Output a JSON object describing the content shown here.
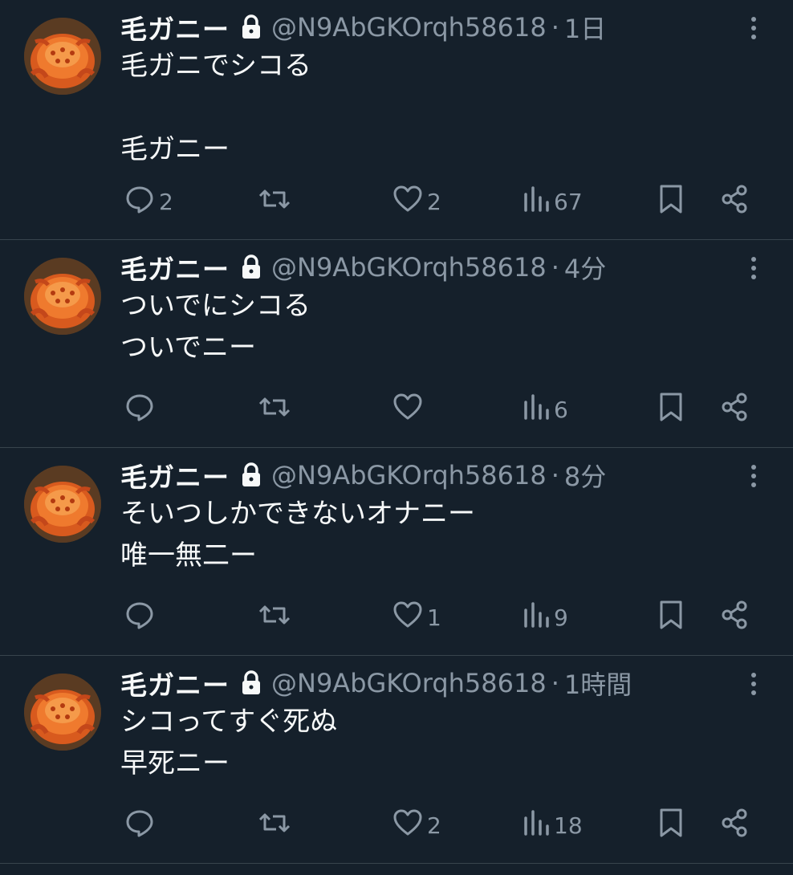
{
  "account": {
    "display_name": "毛ガニー",
    "handle": "@N9AbGKOrqh58618",
    "avatar_icon": "crab-photo-avatar",
    "protected_icon": "lock-icon"
  },
  "separator": "·",
  "tweets": [
    {
      "time": "1日",
      "text": "毛ガニでシコる\n\n毛ガニー",
      "replies": "2",
      "retweets": "",
      "likes": "2",
      "views": "67"
    },
    {
      "time": "4分",
      "text": "ついでにシコる\nついでニー",
      "replies": "",
      "retweets": "",
      "likes": "",
      "views": "6"
    },
    {
      "time": "8分",
      "text": "そいつしかできないオナニー\n唯一無二ー",
      "replies": "",
      "retweets": "",
      "likes": "1",
      "views": "9"
    },
    {
      "time": "1時間",
      "text": "シコってすぐ死ぬ\n早死ニー",
      "replies": "",
      "retweets": "",
      "likes": "2",
      "views": "18"
    }
  ],
  "colors": {
    "background": "#15202b",
    "primary_text": "#f7f9f9",
    "secondary_text": "#8b98a5",
    "divider": "#38444d"
  }
}
